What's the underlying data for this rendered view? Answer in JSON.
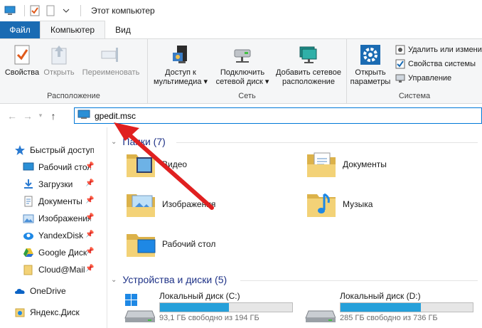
{
  "window": {
    "title": "Этот компьютер"
  },
  "ribbon_tabs": [
    {
      "label": "Файл"
    },
    {
      "label": "Компьютер"
    },
    {
      "label": "Вид"
    }
  ],
  "ribbon": {
    "location_group": {
      "label": "Расположение",
      "properties": "Свойства",
      "open": "Открыть",
      "rename": "Переименовать"
    },
    "network_group": {
      "label": "Сеть",
      "media_line1": "Доступ к",
      "media_line2": "мультимедиа",
      "map_line1": "Подключить",
      "map_line2": "сетевой диск",
      "add_line1": "Добавить сетевое",
      "add_line2": "расположение"
    },
    "system_group": {
      "label": "Система",
      "settings_line1": "Открыть",
      "settings_line2": "параметры",
      "uninstall": "Удалить или измени",
      "sys_props": "Свойства системы",
      "manage": "Управление"
    }
  },
  "address_bar": {
    "value": "gpedit.msc"
  },
  "nav_pane": {
    "items": [
      {
        "label": "Быстрый доступ",
        "icon": "star-icon",
        "pinned": false
      },
      {
        "label": "Рабочий стол",
        "icon": "desktop-icon",
        "pinned": true
      },
      {
        "label": "Загрузки",
        "icon": "download-icon",
        "pinned": true
      },
      {
        "label": "Документы",
        "icon": "document-icon",
        "pinned": true
      },
      {
        "label": "Изображения",
        "icon": "pictures-icon",
        "pinned": true
      },
      {
        "label": "YandexDisk",
        "icon": "yandexdisk-icon",
        "pinned": true
      },
      {
        "label": "Google Диск",
        "icon": "google-drive-icon",
        "pinned": true
      },
      {
        "label": "Cloud@Mail",
        "icon": "folder-icon",
        "pinned": true
      },
      {
        "label": "OneDrive",
        "icon": "onedrive-icon",
        "pinned": false
      },
      {
        "label": "Яндекс.Диск",
        "icon": "yandex-disk-icon",
        "pinned": false
      }
    ]
  },
  "folders_section": {
    "title": "Папки (7)",
    "items": [
      {
        "label": "Видео",
        "icon": "video-folder-icon"
      },
      {
        "label": "Документы",
        "icon": "documents-folder-icon"
      },
      {
        "label": "Изображения",
        "icon": "pictures-folder-icon"
      },
      {
        "label": "Музыка",
        "icon": "music-folder-icon"
      },
      {
        "label": "Рабочий стол",
        "icon": "desktop-folder-icon"
      }
    ]
  },
  "drives_section": {
    "title": "Устройства и диски (5)",
    "items": [
      {
        "label": "Локальный диск (C:)",
        "free": "93,1 ГБ свободно из 194 ГБ",
        "used_fraction": 0.52
      },
      {
        "label": "Локальный диск (D:)",
        "free": "285 ГБ свободно из 736 ГБ",
        "used_fraction": 0.61
      }
    ]
  },
  "colors": {
    "file_tab": "#1a6bb3",
    "section_title": "#1e3287",
    "drive_bar": "#26a0da",
    "arrow": "#e02020",
    "address_border": "#0078d7"
  }
}
